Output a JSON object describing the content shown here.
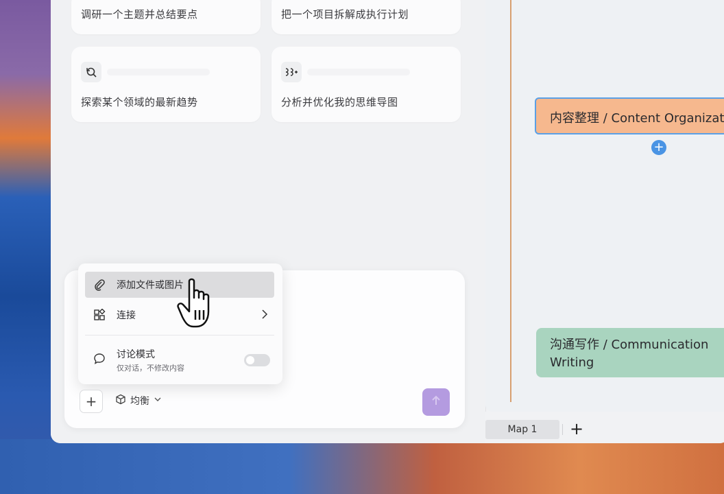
{
  "suggestions": [
    {
      "text": "调研一个主题并总结要点",
      "icon": "research-icon"
    },
    {
      "text": "把一个项目拆解成执行计划",
      "icon": "plan-icon"
    },
    {
      "text": "探索某个领域的最新趋势",
      "icon": "explore-icon"
    },
    {
      "text": "分析并优化我的思维导图",
      "icon": "optimize-icon"
    }
  ],
  "menu": {
    "attach_label": "添加文件或图片",
    "connect_label": "连接",
    "discuss_label": "讨论模式",
    "discuss_sub": "仅对话，不修改内容",
    "discuss_enabled": false
  },
  "composer": {
    "add_label": "+",
    "model_label": "均衡",
    "model_chevron": "⌄"
  },
  "mindmap": {
    "node1": "内容整理 / Content Organization",
    "node2": "沟通写作 / Communication Writing",
    "add_node": "+",
    "node1_color": "#f6b88e",
    "node2_color": "#a9d4bf",
    "selection_color": "#5aa0e6"
  },
  "tabs": {
    "active": "Map 1",
    "add_label": "+"
  },
  "colors": {
    "send_button": "#b49be0"
  }
}
